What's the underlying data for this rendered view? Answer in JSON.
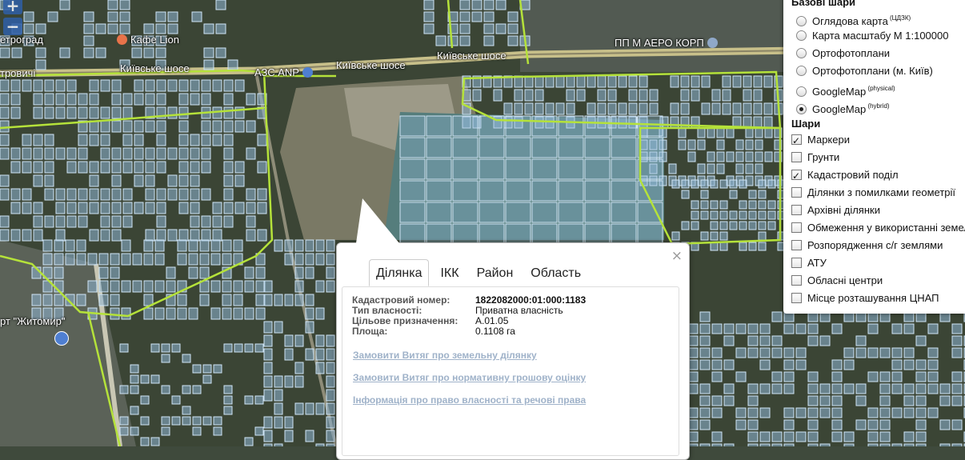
{
  "map": {
    "zoom_in": "+",
    "zoom_out": "−",
    "labels": {
      "cafe": "Кафе Lion",
      "kyiv_road_1": "Київське шосе",
      "kyiv_road_2": "Київське шосе",
      "kyiv_road_3": "Київське шосе",
      "azs": "АЗС ANP",
      "aero": "ПП М АЕРО КОРП",
      "airport": "рт \"Житомир\"",
      "left1": "етроград",
      "left2": "тровичі"
    },
    "colors": {
      "parcel_fill": "#8fb6d6",
      "parcel_stroke": "#cfe4f5",
      "boundary": "#b5e23a",
      "road": "#c8c08a"
    }
  },
  "layers": {
    "base_title": "Базові шари",
    "base": [
      {
        "label": "Оглядова карта",
        "sup": "(ЦДЗК)",
        "selected": false
      },
      {
        "label": "Карта масштабу М 1:100000",
        "sup": "",
        "selected": false
      },
      {
        "label": "Ортофотоплани",
        "sup": "",
        "selected": false
      },
      {
        "label": "Ортофотоплани (м. Київ)",
        "sup": "",
        "selected": false
      },
      {
        "label": "GoogleMap",
        "sup": "(physical)",
        "selected": false
      },
      {
        "label": "GoogleMap",
        "sup": "(hybrid)",
        "selected": true
      }
    ],
    "overlay_title": "Шари",
    "overlay": [
      {
        "label": "Маркери",
        "checked": true
      },
      {
        "label": "Грунти",
        "checked": false
      },
      {
        "label": "Кадастровий поділ",
        "checked": true
      },
      {
        "label": "Ділянки з помилками геометрії",
        "checked": false
      },
      {
        "label": "Архівні ділянки",
        "checked": false
      },
      {
        "label": "Обмеження у використанні земель",
        "checked": false
      },
      {
        "label": "Розпорядження с/г землями",
        "checked": false
      },
      {
        "label": "АТУ",
        "checked": false
      },
      {
        "label": "Обласні центри",
        "checked": false
      },
      {
        "label": "Місце розташування ЦНАП",
        "checked": false
      }
    ]
  },
  "popup": {
    "close": "×",
    "tabs": [
      "Ділянка",
      "ІКК",
      "Район",
      "Область"
    ],
    "active_tab": "Ділянка",
    "fields": [
      {
        "key": "Кадастровий номер:",
        "value": "1822082000:01:000:1183"
      },
      {
        "key": "Тип власності:",
        "value": "Приватна власність"
      },
      {
        "key": "Цільове призначення:",
        "value": "А.01.05"
      },
      {
        "key": "Площа:",
        "value": "0.1108 га"
      }
    ],
    "links": [
      "Замовити Витяг про земельну ділянку",
      "Замовити Витяг про нормативну грошову оцінку",
      "Інформація про право власності та речові права"
    ]
  }
}
